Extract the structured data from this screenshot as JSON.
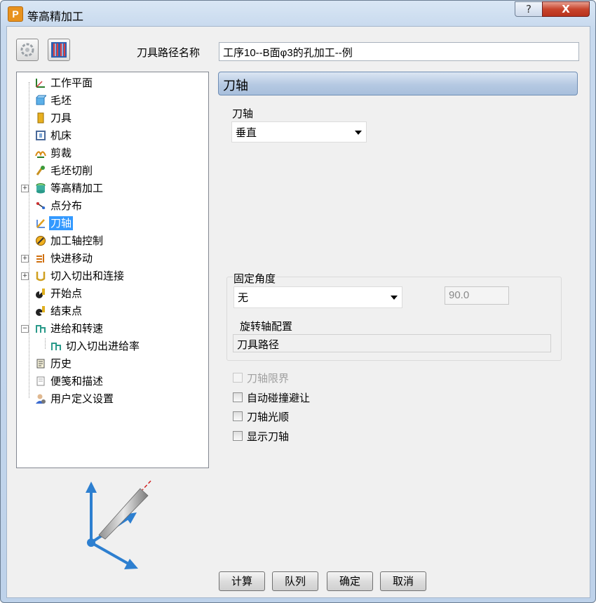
{
  "window": {
    "title": "等高精加工",
    "app_icon_letter": "P",
    "help_label": "?",
    "close_label": "X"
  },
  "toolbar": {
    "icon1": "recycle-gear-icon",
    "icon2": "toolpath-stripes-icon"
  },
  "toolpath_name": {
    "label": "刀具路径名称",
    "value": "工序10--B面φ3的孔加工--例"
  },
  "tree": {
    "items": [
      {
        "label": "工作平面",
        "icon": "workplane-icon"
      },
      {
        "label": "毛坯",
        "icon": "block-icon"
      },
      {
        "label": "刀具",
        "icon": "tool-icon"
      },
      {
        "label": "机床",
        "icon": "machine-icon"
      },
      {
        "label": "剪裁",
        "icon": "limit-icon"
      },
      {
        "label": "毛坯切削",
        "icon": "stock-cut-icon"
      },
      {
        "label": "等高精加工",
        "icon": "constant-z-icon"
      },
      {
        "label": "点分布",
        "icon": "point-distribution-icon"
      },
      {
        "label": "刀轴",
        "icon": "tool-axis-icon"
      },
      {
        "label": "加工轴控制",
        "icon": "axis-control-icon"
      },
      {
        "label": "快进移动",
        "icon": "rapid-move-icon"
      },
      {
        "label": "切入切出和连接",
        "icon": "leads-links-icon"
      },
      {
        "label": "开始点",
        "icon": "start-point-icon"
      },
      {
        "label": "结束点",
        "icon": "end-point-icon"
      },
      {
        "label": "进给和转速",
        "icon": "feeds-speeds-icon"
      },
      {
        "label": "切入切出进给率",
        "icon": "lead-feed-icon"
      },
      {
        "label": "历史",
        "icon": "history-icon"
      },
      {
        "label": "便笺和描述",
        "icon": "notes-icon"
      },
      {
        "label": "用户定义设置",
        "icon": "user-settings-icon"
      }
    ],
    "selected_index": 8
  },
  "panel": {
    "title": "刀轴",
    "tool_axis_label": "刀轴",
    "tool_axis_value": "垂直",
    "fixed_angle_label": "固定角度",
    "fixed_angle_value": "无",
    "angle_value": "90.0",
    "rotary_config_label": "旋转轴配置",
    "rotary_config_value": "刀具路径",
    "checkboxes": [
      {
        "label": "刀轴限界",
        "checked": false,
        "enabled": false
      },
      {
        "label": "自动碰撞避让",
        "checked": false,
        "enabled": true
      },
      {
        "label": "刀轴光顺",
        "checked": false,
        "enabled": true
      },
      {
        "label": "显示刀轴",
        "checked": false,
        "enabled": true
      }
    ]
  },
  "buttons": {
    "calculate": "计算",
    "queue": "队列",
    "ok": "确定",
    "cancel": "取消"
  },
  "colors": {
    "selection": "#3399ff",
    "header": "#b5c9e2",
    "axis_arrow": "#2d7fd0"
  }
}
